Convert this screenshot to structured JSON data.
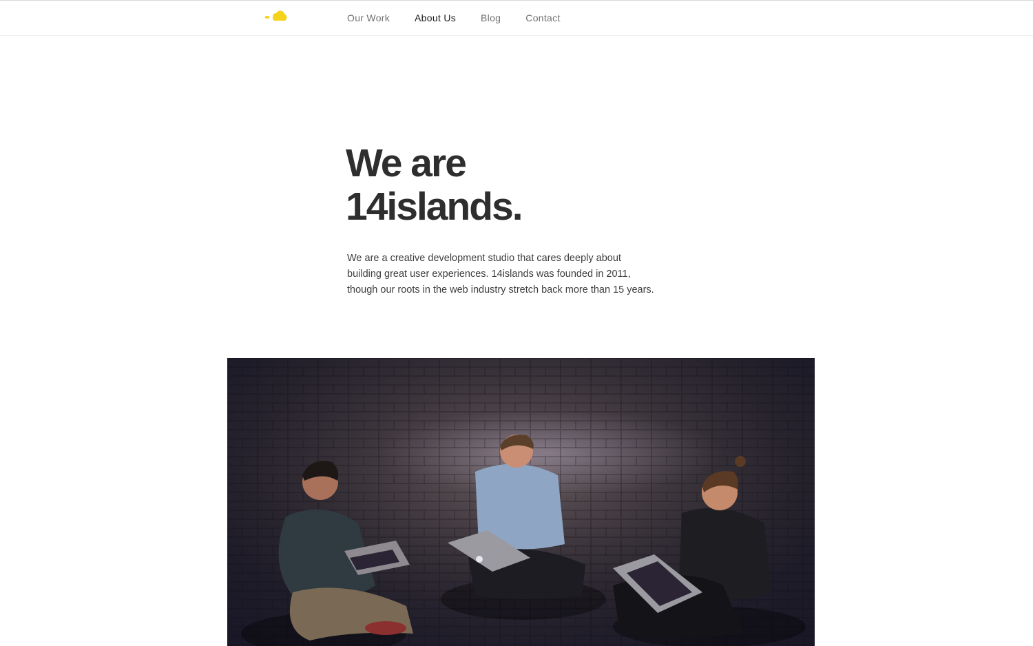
{
  "nav": {
    "items": [
      {
        "label": "Our Work",
        "active": false
      },
      {
        "label": "About Us",
        "active": true
      },
      {
        "label": "Blog",
        "active": false
      },
      {
        "label": "Contact",
        "active": false
      }
    ]
  },
  "hero_heading": {
    "line1": "We are",
    "line2": "14islands."
  },
  "intro": {
    "line1": "We are a creative development studio that cares deeply about",
    "line2": "building great user experiences. 14islands was founded in 2011,",
    "line3": "though our roots in the web industry stretch back more than 15 years."
  },
  "colors": {
    "logo_yellow": "#f5d31b",
    "heading": "#2e2e2e",
    "nav_inactive": "#707070",
    "nav_active": "#1b1b1b"
  },
  "icons": {
    "logo": "cloud-islands-logo"
  }
}
